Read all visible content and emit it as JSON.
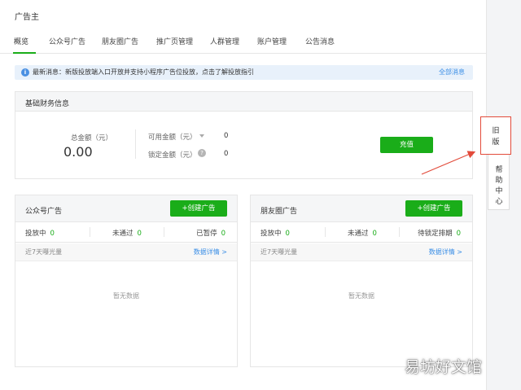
{
  "header": {
    "title": "广告主"
  },
  "tabs": [
    {
      "label": "概览",
      "active": true
    },
    {
      "label": "公众号广告"
    },
    {
      "label": "朋友圈广告"
    },
    {
      "label": "推广页管理"
    },
    {
      "label": "人群管理"
    },
    {
      "label": "账户管理"
    },
    {
      "label": "公告消息"
    }
  ],
  "notice": {
    "icon": "info-icon",
    "icon_glyph": "i",
    "text": "最新消息：新版投放端入口开放并支持小程序广告位投放，点击了解投放指引",
    "link": "全部消息"
  },
  "finance": {
    "title": "基础财务信息",
    "total_label": "总金额（元）",
    "total_value": "0.00",
    "available_label": "可用金额（元）",
    "available_value": "0",
    "locked_label": "锁定金额（元）",
    "locked_help": "?",
    "locked_value": "0",
    "recharge_label": "充值"
  },
  "official_ads": {
    "title": "公众号广告",
    "create_label": "+创建广告",
    "stats": [
      {
        "label": "投放中",
        "value": "0"
      },
      {
        "label": "未通过",
        "value": "0"
      },
      {
        "label": "已暂停",
        "value": "0"
      }
    ],
    "exposure_label": "近7天曝光量",
    "detail_link": "数据详情 >",
    "empty_text": "暂无数据"
  },
  "moments_ads": {
    "title": "朋友圈广告",
    "create_label": "+创建广告",
    "stats": [
      {
        "label": "投放中",
        "value": "0"
      },
      {
        "label": "未通过",
        "value": "0"
      },
      {
        "label": "待锁定排期",
        "value": "0"
      }
    ],
    "exposure_label": "近7天曝光量",
    "detail_link": "数据详情 >",
    "empty_text": "暂无数据"
  },
  "side": {
    "old_version_line1": "旧",
    "old_version_line2": "版",
    "help_line1": "帮",
    "help_line2": "助",
    "help_line3": "中",
    "help_line4": "心"
  },
  "watermark": "易坊好文馆",
  "colors": {
    "accent_green": "#1aad19",
    "link_blue": "#3a8ee6",
    "highlight_red": "#e24b3b",
    "notice_bg": "#e8f1fb"
  }
}
